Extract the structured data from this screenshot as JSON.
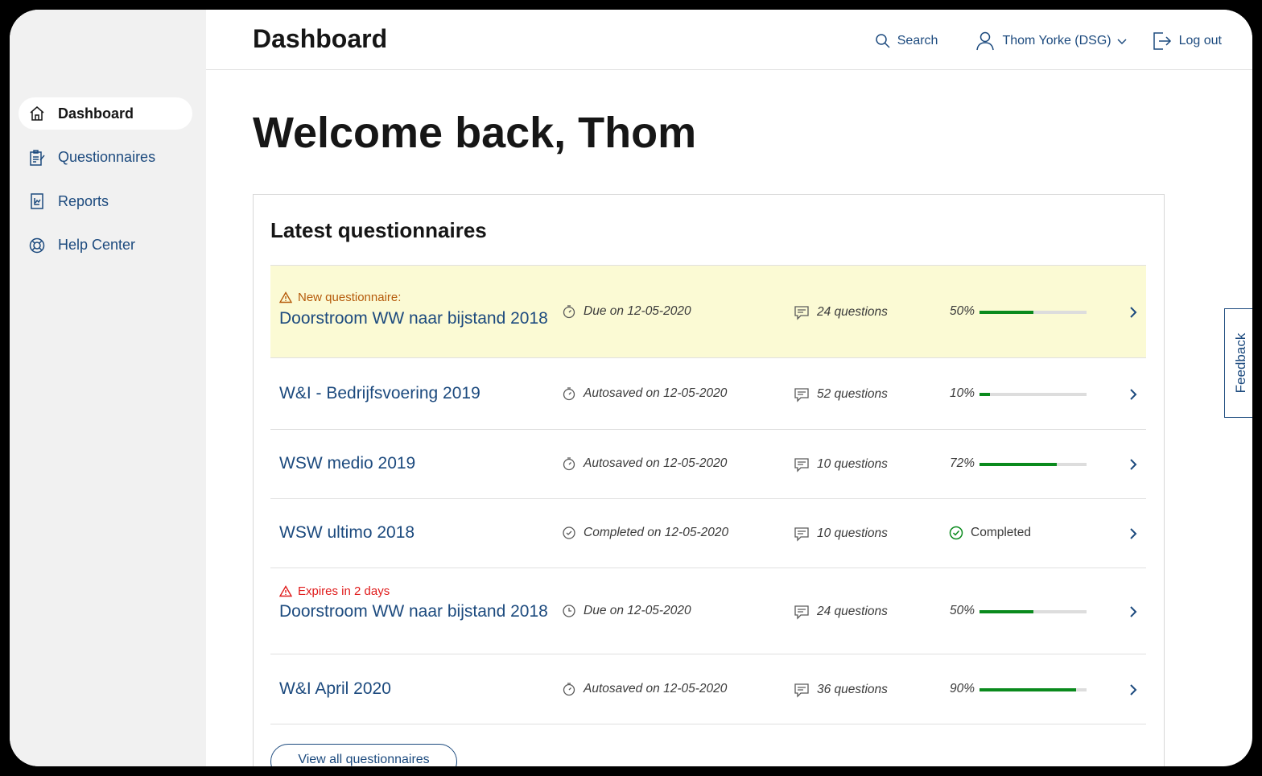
{
  "header": {
    "page_title": "Dashboard",
    "search_label": "Search",
    "user_label": "Thom Yorke (DSG)",
    "logout_label": "Log out"
  },
  "sidebar": {
    "items": [
      {
        "label": "Dashboard",
        "icon": "home-icon",
        "active": true
      },
      {
        "label": "Questionnaires",
        "icon": "questionnaire-icon",
        "active": false
      },
      {
        "label": "Reports",
        "icon": "report-icon",
        "active": false
      },
      {
        "label": "Help Center",
        "icon": "lifebuoy-icon",
        "active": false
      }
    ]
  },
  "main": {
    "welcome": "Welcome back, Thom",
    "card_title": "Latest questionnaires",
    "view_all_label": "View all questionnaires"
  },
  "questionnaires": [
    {
      "alert": "New questionnaire:",
      "alert_type": "warning",
      "title": "Doorstroom WW naar bijstand 2018",
      "date_text": "Due on 12-05-2020",
      "questions": "24 questions",
      "progress_label": "50%",
      "progress": 0.5,
      "highlight": true
    },
    {
      "title": "W&I - Bedrijfsvoering 2019",
      "date_text": "Autosaved on 12-05-2020",
      "questions": "52 questions",
      "progress_label": "10%",
      "progress": 0.1
    },
    {
      "title": "WSW medio 2019",
      "date_text": "Autosaved on 12-05-2020",
      "questions": "10 questions",
      "progress_label": "72%",
      "progress": 0.72
    },
    {
      "title": "WSW ultimo 2018",
      "date_text": "Completed on 12-05-2020",
      "questions": "10 questions",
      "status": "Completed"
    },
    {
      "alert": "Expires in 2 days",
      "alert_type": "danger",
      "title": "Doorstroom WW naar bijstand 2018",
      "date_text": "Due on 12-05-2020",
      "questions": "24 questions",
      "progress_label": "50%",
      "progress": 0.5
    },
    {
      "title": "W&I April 2020",
      "date_text": "Autosaved on 12-05-2020",
      "questions": "36 questions",
      "progress_label": "90%",
      "progress": 0.9
    }
  ],
  "feedback_label": "Feedback",
  "colors": {
    "link": "#1c4a7e",
    "progress": "#0a8a1d",
    "warning": "#b55a0a",
    "danger": "#e01b1b",
    "highlight": "#fbfad4",
    "sidebar_bg": "#f1f1f1"
  }
}
